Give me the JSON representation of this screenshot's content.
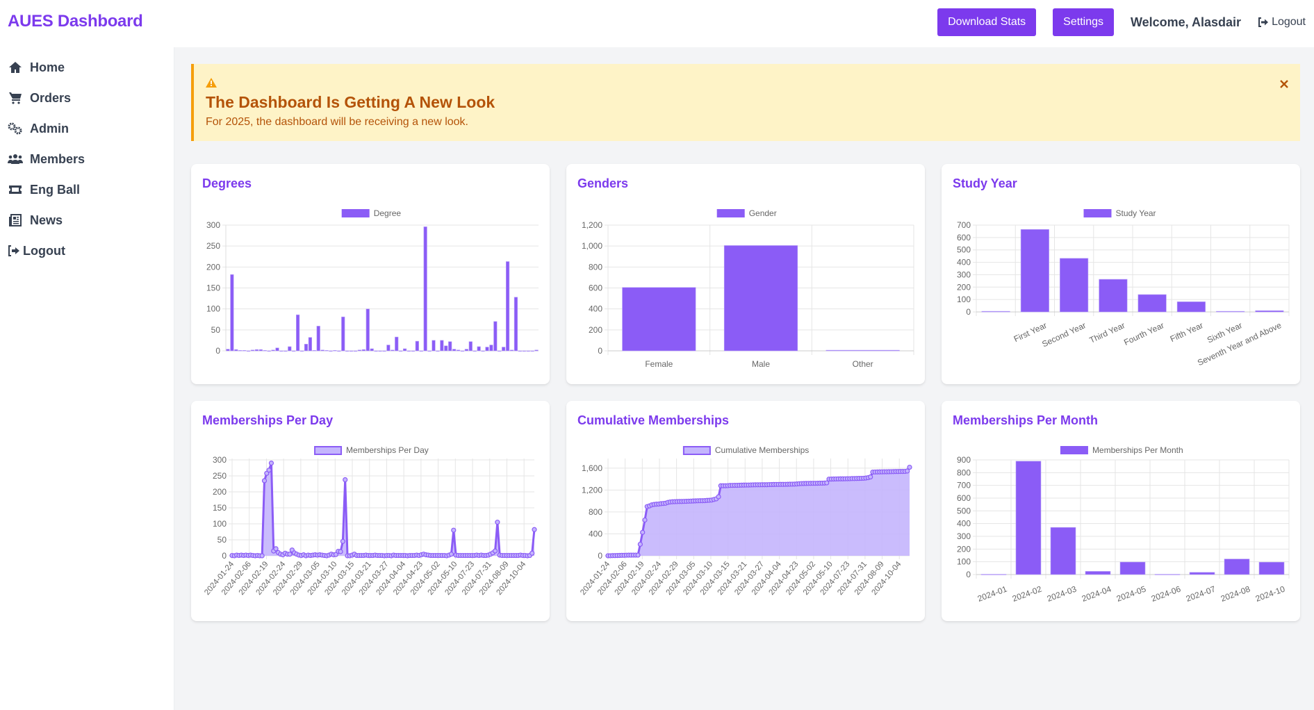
{
  "header": {
    "brand": "AUES Dashboard",
    "download_label": "Download Stats",
    "settings_label": "Settings",
    "welcome": "Welcome, Alasdair",
    "logout_label": "Logout"
  },
  "sidebar": {
    "items": [
      {
        "label": "Home",
        "icon": "home-icon"
      },
      {
        "label": "Orders",
        "icon": "cart-icon"
      },
      {
        "label": "Admin",
        "icon": "cogs-icon"
      },
      {
        "label": "Members",
        "icon": "users-icon"
      },
      {
        "label": "Eng Ball",
        "icon": "ticket-icon"
      },
      {
        "label": "News",
        "icon": "newspaper-icon"
      },
      {
        "label": "Logout",
        "icon": "sign-out-icon"
      }
    ]
  },
  "alert": {
    "icon": "warning-icon",
    "title": "The Dashboard Is Getting A New Look",
    "message": "For 2025, the dashboard will be receiving a new look.",
    "close_icon": "close-icon"
  },
  "colors": {
    "accent": "#7c3aed",
    "bar": "#8b5cf6",
    "area_fill": "#c4b5fd",
    "alert_bg": "#fef3c7",
    "alert_border": "#f59e0b",
    "alert_text": "#b45309"
  },
  "chart_data": [
    {
      "id": "degrees",
      "title": "Degrees",
      "type": "bar",
      "legend": "Degree",
      "legend_position": "top",
      "ylim": [
        0,
        300
      ],
      "yticks": [
        0,
        50,
        100,
        150,
        200,
        250,
        300
      ],
      "categories_hidden": true,
      "values": [
        4,
        182,
        3,
        1,
        1,
        0,
        2,
        3,
        3,
        1,
        0,
        2,
        7,
        0,
        0,
        10,
        0,
        86,
        0,
        16,
        32,
        1,
        59,
        2,
        1,
        0,
        1,
        0,
        81,
        0,
        0,
        0,
        2,
        3,
        100,
        5,
        0,
        0,
        0,
        14,
        2,
        33,
        0,
        5,
        0,
        0,
        23,
        0,
        296,
        0,
        25,
        0,
        25,
        12,
        22,
        4,
        2,
        0,
        4,
        22,
        0,
        10,
        0,
        9,
        14,
        70,
        0,
        9,
        213,
        2,
        128,
        0,
        0,
        0,
        0,
        2
      ],
      "grid": true
    },
    {
      "id": "genders",
      "title": "Genders",
      "type": "bar",
      "legend": "Gender",
      "legend_position": "top",
      "categories": [
        "Female",
        "Male",
        "Other"
      ],
      "values": [
        605,
        1005,
        6
      ],
      "ylim": [
        0,
        1200
      ],
      "yticks": [
        0,
        200,
        400,
        600,
        800,
        1000,
        1200
      ],
      "ytick_labels": [
        "0",
        "200",
        "400",
        "600",
        "800",
        "1,000",
        "1,200"
      ],
      "grid": true
    },
    {
      "id": "study-year",
      "title": "Study Year",
      "type": "bar",
      "legend": "Study Year",
      "legend_position": "top",
      "categories": [
        "",
        "First Year",
        "Second Year",
        "Third Year",
        "Fourth Year",
        "Fifth Year",
        "Sixth Year",
        "Seventh Year and Above"
      ],
      "values": [
        5,
        665,
        432,
        263,
        140,
        82,
        5,
        10
      ],
      "ylim": [
        0,
        700
      ],
      "yticks": [
        0,
        100,
        200,
        300,
        400,
        500,
        600,
        700
      ],
      "grid": true
    },
    {
      "id": "memberships-per-day",
      "title": "Memberships Per Day",
      "type": "area",
      "legend": "Memberships Per Day",
      "legend_position": "top",
      "x_tick_labels": [
        "2024-01-24",
        "2024-02-06",
        "2024-02-19",
        "2024-02-24",
        "2024-02-29",
        "2024-03-05",
        "2024-03-10",
        "2024-03-15",
        "2024-03-21",
        "2024-03-27",
        "2024-04-04",
        "2024-04-23",
        "2024-05-02",
        "2024-05-10",
        "2024-07-23",
        "2024-07-31",
        "2024-08-09",
        "2024-10-04"
      ],
      "values": [
        1,
        0,
        2,
        1,
        2,
        1,
        2,
        1,
        2,
        1,
        0,
        1,
        0,
        0,
        235,
        258,
        268,
        290,
        15,
        22,
        10,
        5,
        3,
        8,
        5,
        5,
        18,
        9,
        5,
        2,
        1,
        3,
        0,
        2,
        1,
        2,
        3,
        2,
        3,
        2,
        1,
        0,
        2,
        5,
        3,
        4,
        14,
        13,
        45,
        238,
        0,
        0,
        2,
        5,
        1,
        1,
        1,
        1,
        2,
        1,
        1,
        1,
        2,
        1,
        1,
        1,
        0,
        1,
        1,
        0,
        2,
        1,
        1,
        1,
        1,
        1,
        0,
        1,
        1,
        1,
        2,
        1,
        3,
        5,
        3,
        2,
        1,
        1,
        1,
        1,
        1,
        1,
        1,
        0,
        2,
        5,
        80,
        2,
        1,
        1,
        1,
        1,
        1,
        1,
        1,
        1,
        2,
        1,
        2,
        1,
        1,
        2,
        5,
        9,
        15,
        105,
        2,
        1,
        1,
        1,
        1,
        1,
        1,
        1,
        1,
        2,
        1,
        1,
        0,
        1,
        8,
        82
      ],
      "ylim": [
        0,
        300
      ],
      "yticks": [
        0,
        50,
        100,
        150,
        200,
        250,
        300
      ],
      "grid": true
    },
    {
      "id": "cumulative-memberships",
      "title": "Cumulative Memberships",
      "type": "area",
      "legend": "Cumulative Memberships",
      "legend_position": "top",
      "x_tick_labels": [
        "2024-01-24",
        "2024-02-06",
        "2024-02-19",
        "2024-02-24",
        "2024-02-29",
        "2024-03-05",
        "2024-03-10",
        "2024-03-15",
        "2024-03-21",
        "2024-03-27",
        "2024-04-04",
        "2024-04-23",
        "2024-05-02",
        "2024-05-10",
        "2024-07-23",
        "2024-07-31",
        "2024-08-09",
        "2024-10-04"
      ],
      "ylim": [
        0,
        1750
      ],
      "yticks": [
        0,
        400,
        800,
        1200,
        1600
      ],
      "ytick_labels": [
        "0",
        "400",
        "800",
        "1,200",
        "1,600"
      ],
      "derived_from": "memberships-per-day",
      "final_value": 1616,
      "grid": true
    },
    {
      "id": "memberships-per-month",
      "title": "Memberships Per Month",
      "type": "bar",
      "legend": "Memberships Per Month",
      "legend_position": "top",
      "categories": [
        "2024-01",
        "2024-02",
        "2024-03",
        "2024-04",
        "2024-05",
        "2024-06",
        "2024-07",
        "2024-08",
        "2024-10"
      ],
      "values": [
        2,
        890,
        370,
        25,
        98,
        2,
        17,
        122,
        97
      ],
      "ylim": [
        0,
        900
      ],
      "yticks": [
        0,
        100,
        200,
        300,
        400,
        500,
        600,
        700,
        800,
        900
      ],
      "grid": true
    }
  ]
}
